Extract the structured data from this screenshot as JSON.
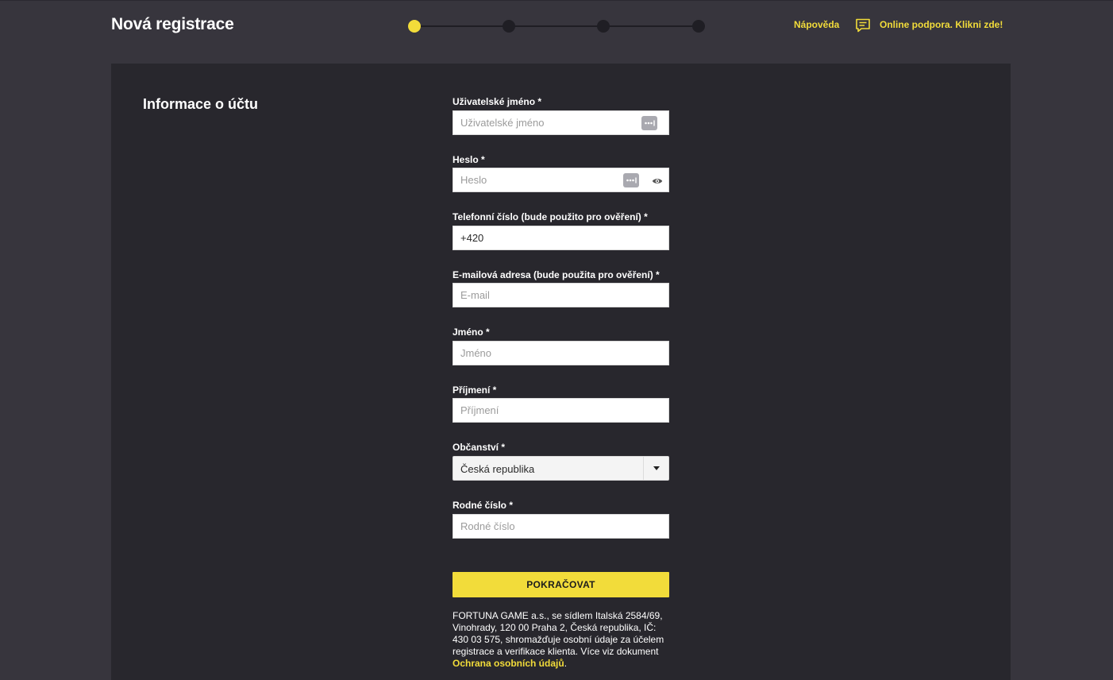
{
  "header": {
    "title": "Nová registrace",
    "help_label": "Nápověda",
    "support_label": "Online podpora. Klikni zde!",
    "steps": [
      {
        "state": "active"
      },
      {
        "state": "inactive"
      },
      {
        "state": "inactive"
      },
      {
        "state": "inactive"
      }
    ]
  },
  "section": {
    "title": "Informace o účtu"
  },
  "form": {
    "username": {
      "label": "Uživatelské jméno *",
      "placeholder": "Uživatelské jméno",
      "value": ""
    },
    "password": {
      "label": "Heslo *",
      "placeholder": "Heslo",
      "value": ""
    },
    "phone": {
      "label": "Telefonní číslo (bude použito pro ověření) *",
      "placeholder": "",
      "value": "+420"
    },
    "email": {
      "label": "E-mailová adresa (bude použita pro ověření) *",
      "placeholder": "E-mail",
      "value": ""
    },
    "first_name": {
      "label": "Jméno *",
      "placeholder": "Jméno",
      "value": ""
    },
    "last_name": {
      "label": "Příjmení *",
      "placeholder": "Příjmení",
      "value": ""
    },
    "citizenship": {
      "label": "Občanství *",
      "selected": "Česká republika"
    },
    "birth_number": {
      "label": "Rodné číslo *",
      "placeholder": "Rodné číslo",
      "value": ""
    },
    "continue_label": "POKRAČOVAT"
  },
  "disclaimer": {
    "text": "FORTUNA GAME a.s., se sídlem Italská 2584/69, Vinohrady, 120 00 Praha 2, Česká republika, IČ: 430 03 575, shromažďuje osobní údaje za účelem registrace a verifikace klienta. Více viz dokument ",
    "link_label": "Ochrana osobních údajů",
    "tail": "."
  },
  "colors": {
    "accent": "#f2dc3a",
    "background": "#37353d",
    "panel": "#28272d"
  }
}
